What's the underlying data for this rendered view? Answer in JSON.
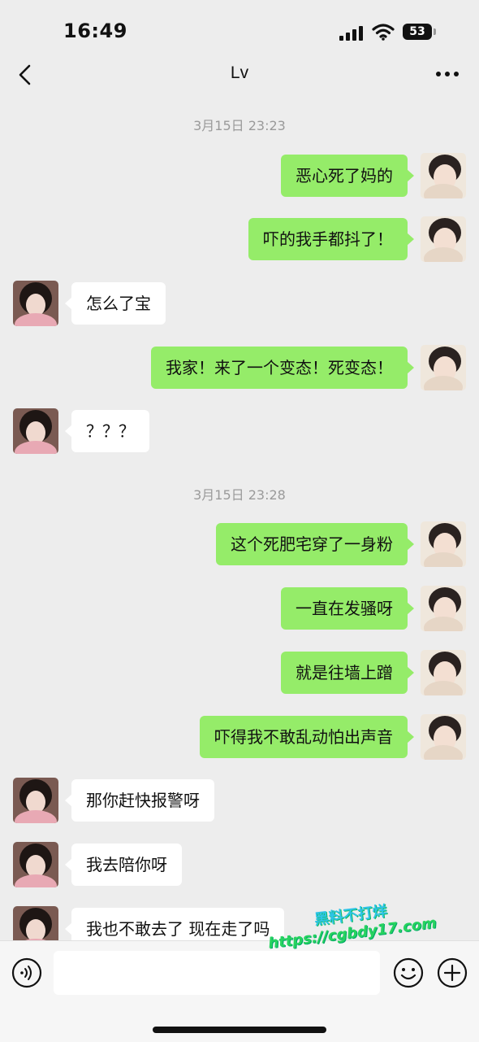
{
  "status": {
    "time": "16:49",
    "battery": "53"
  },
  "nav": {
    "title": "Lv"
  },
  "timestamps": [
    "3月15日 23:23",
    "3月15日 23:28"
  ],
  "messages": [
    {
      "side": "out",
      "text": "恶心死了妈的"
    },
    {
      "side": "out",
      "text": "吓的我手都抖了！"
    },
    {
      "side": "in",
      "text": "怎么了宝"
    },
    {
      "side": "out",
      "text": "我家！来了一个变态！死变态！"
    },
    {
      "side": "in",
      "text": "？？？"
    },
    {
      "side": "out",
      "text": "这个死肥宅穿了一身粉"
    },
    {
      "side": "out",
      "text": "一直在发骚呀"
    },
    {
      "side": "out",
      "text": "就是往墙上蹭"
    },
    {
      "side": "out",
      "text": "吓得我不敢乱动怕出声音"
    },
    {
      "side": "in",
      "text": "那你赶快报警呀"
    },
    {
      "side": "in",
      "text": "我去陪你呀"
    },
    {
      "side": "in",
      "text": "我也不敢去了 现在走了吗"
    }
  ],
  "input": {
    "value": "",
    "placeholder": ""
  },
  "icons": {
    "back": "chevron-left-icon",
    "more": "more-dots-icon",
    "voice": "voice-icon",
    "emoji": "emoji-icon",
    "plus": "plus-icon"
  },
  "colors": {
    "outgoing_bubble": "#95ec69",
    "incoming_bubble": "#ffffff",
    "background": "#ededed"
  },
  "watermark": {
    "line1": "黑料不打烊",
    "line2": "https://cgbdy17.com"
  }
}
